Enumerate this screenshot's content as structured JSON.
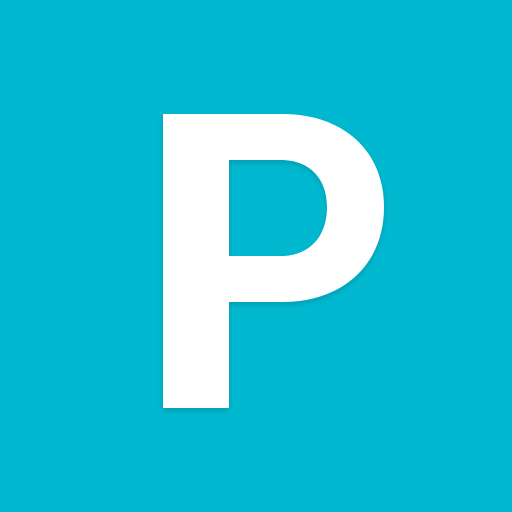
{
  "icon": {
    "name": "letter-p-icon",
    "letter": "P",
    "background_color": "#00b8d0",
    "glyph_color": "#ffffff"
  }
}
